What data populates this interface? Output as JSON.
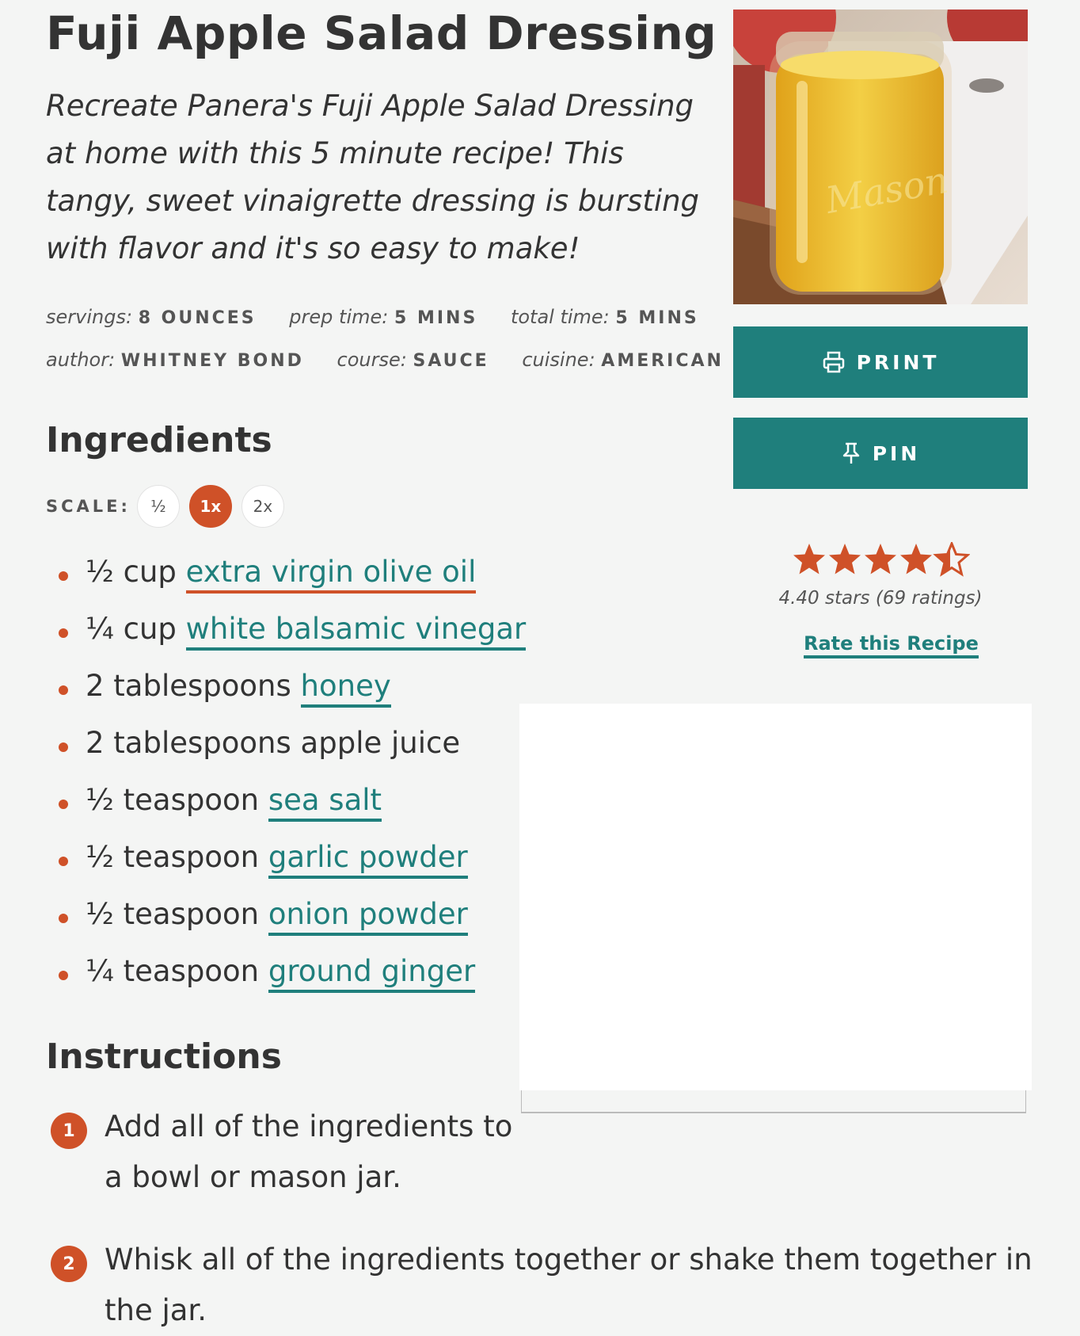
{
  "recipe": {
    "title": "Fuji Apple Salad Dressing",
    "summary": "Recreate Panera's Fuji Apple Salad Dressing at home with this 5 minute recipe! This tangy, sweet vinaigrette dressing is bursting with flavor and it's so easy to make!",
    "meta": {
      "servings_label": "servings:",
      "servings_value": "8 ounces",
      "prep_label": "prep time:",
      "prep_value": "5 mins",
      "total_label": "total time:",
      "total_value": "5 mins",
      "author_label": "author:",
      "author_value": "Whitney Bond",
      "course_label": "course:",
      "course_value": "Sauce",
      "cuisine_label": "cuisine:",
      "cuisine_value": "American"
    }
  },
  "actions": {
    "print_label": "PRINT",
    "pin_label": "PIN"
  },
  "rating": {
    "value": 4.4,
    "text": "4.40 stars (69 ratings)",
    "rate_link": "Rate this Recipe"
  },
  "ingredients": {
    "heading": "Ingredients",
    "scale_label": "SCALE:",
    "scale_options": [
      "½",
      "1x",
      "2x"
    ],
    "scale_selected": "1x",
    "items": [
      {
        "amount": "½ cup",
        "name": "extra virgin olive oil"
      },
      {
        "amount": "¼ cup",
        "name": "white balsamic vinegar"
      },
      {
        "amount": "2 tablespoons",
        "name": "honey"
      },
      {
        "amount": "2 tablespoons",
        "name": "apple juice"
      },
      {
        "amount": "½ teaspoon",
        "name": "sea salt"
      },
      {
        "amount": "½ teaspoon",
        "name": "garlic powder"
      },
      {
        "amount": "½ teaspoon",
        "name": "onion powder"
      },
      {
        "amount": "¼ teaspoon",
        "name": "ground ginger"
      }
    ]
  },
  "instructions": {
    "heading": "Instructions",
    "steps": [
      {
        "num": "1",
        "line1": "Add all of the ingredients to",
        "line2": "a bowl or mason jar."
      },
      {
        "num": "2",
        "line1": "Whisk all of the ingredients together or shake them together in",
        "line2": "the jar."
      }
    ]
  },
  "colors": {
    "accent_teal": "#1f7f7c",
    "accent_orange": "#cf5128",
    "background": "#f4f5f4"
  }
}
